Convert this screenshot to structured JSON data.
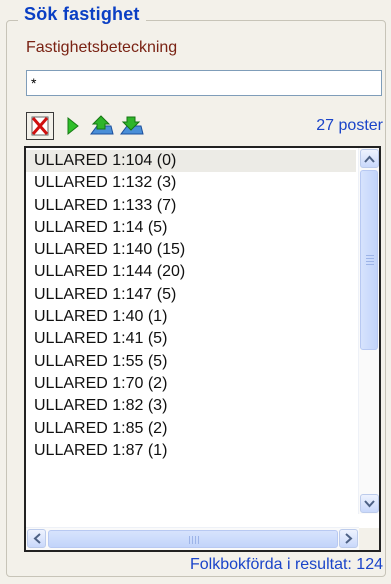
{
  "group": {
    "title": "Sök fastighet"
  },
  "form": {
    "field_label": "Fastighetsbeteckning",
    "search_value": "*"
  },
  "toolbar": {
    "count_label": "27 poster",
    "icons": [
      "clear-icon",
      "run-icon",
      "move-up-icon",
      "move-down-icon"
    ]
  },
  "results": {
    "items": [
      "ULLARED 1:104 (0)",
      "ULLARED 1:132 (3)",
      "ULLARED 1:133 (7)",
      "ULLARED 1:14 (5)",
      "ULLARED 1:140 (15)",
      "ULLARED 1:144 (20)",
      "ULLARED 1:147 (5)",
      "ULLARED 1:40 (1)",
      "ULLARED 1:41 (5)",
      "ULLARED 1:55 (5)",
      "ULLARED 1:70 (2)",
      "ULLARED 1:82 (3)",
      "ULLARED 1:85 (2)",
      "ULLARED 1:87 (1)"
    ],
    "selected_index": 0
  },
  "footer": {
    "label": "Folkbokförda i resultat: 124"
  },
  "colors": {
    "title": "#0a3fc4",
    "label": "#7a2314",
    "link_blue": "#1a44c9",
    "scroll_accent": "#c2d4fa"
  }
}
